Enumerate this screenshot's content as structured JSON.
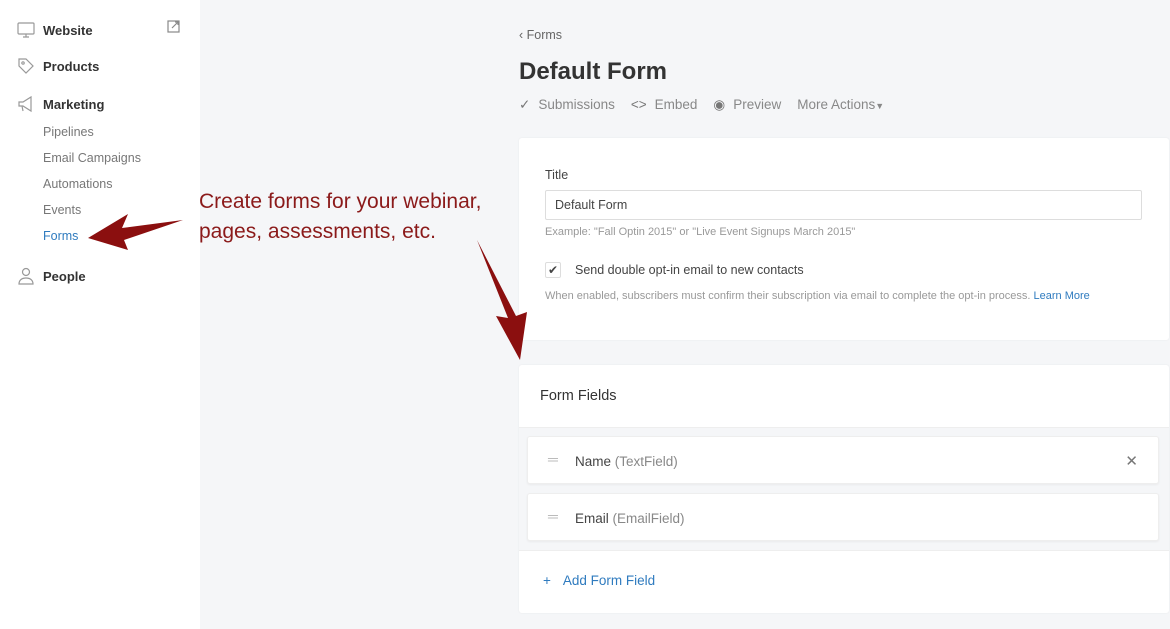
{
  "sidebar": {
    "items": [
      {
        "label": "Website",
        "icon": "monitor-icon"
      },
      {
        "label": "Products",
        "icon": "tag-icon"
      },
      {
        "label": "Marketing",
        "icon": "megaphone-icon"
      },
      {
        "label": "People",
        "icon": "person-icon"
      }
    ],
    "sub": [
      "Pipelines",
      "Email Campaigns",
      "Automations",
      "Events",
      "Forms"
    ],
    "active": "Forms"
  },
  "header": {
    "back": "Forms",
    "title": "Default Form",
    "actions": [
      "Submissions",
      "Embed",
      "Preview",
      "More Actions"
    ]
  },
  "settings": {
    "title_label": "Title",
    "title_value": "Default Form",
    "title_hint": "Example: \"Fall Optin 2015\" or \"Live Event Signups March 2015\"",
    "double_optin_label": "Send double opt-in email to new contacts",
    "double_optin_checked": true,
    "double_optin_hint": "When enabled, subscribers must confirm their subscription via email to complete the opt-in process.",
    "learn_more": "Learn More"
  },
  "fields": {
    "heading": "Form Fields",
    "items": [
      {
        "name": "Name",
        "type": "(TextField)"
      },
      {
        "name": "Email",
        "type": "(EmailField)"
      }
    ],
    "add": "Add Form Field"
  },
  "annotation": {
    "line1": "Create forms for your webinar,",
    "line2": "pages, assessments, etc.",
    "color": "#8b1a1a"
  }
}
